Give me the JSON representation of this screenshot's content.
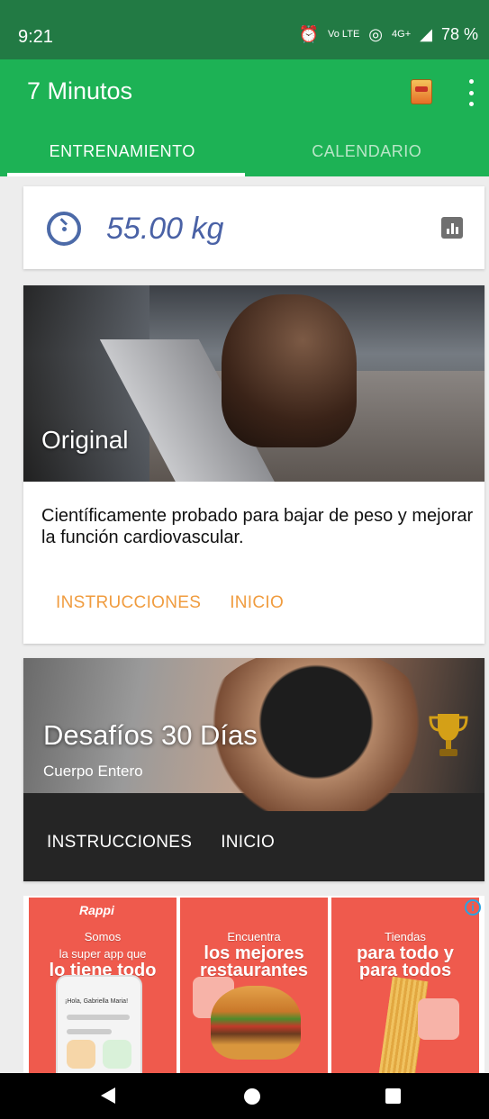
{
  "status_bar": {
    "time": "9:21",
    "icons": [
      "alarm-icon",
      "volte-icon",
      "hotspot-icon",
      "signal-icon",
      "battery-icon"
    ],
    "network": "4G+",
    "volte": "Vo LTE",
    "battery": "78 %"
  },
  "app_bar": {
    "title": "7 Minutos",
    "color": "#1db255"
  },
  "tabs": [
    {
      "label": "ENTRENAMIENTO",
      "active": true
    },
    {
      "label": "CALENDARIO",
      "active": false
    }
  ],
  "weight_card": {
    "value": "55.00 kg"
  },
  "original_card": {
    "title": "Original",
    "description": "Científicamente probado para bajar de peso y mejorar la función cardiovascular.",
    "actions": [
      "INSTRUCCIONES",
      "INICIO"
    ],
    "accent": "#f09c3f"
  },
  "challenge_card": {
    "title": "Desafíos 30 Días",
    "subtitle": "Cuerpo Entero",
    "actions": [
      "INSTRUCCIONES",
      "INICIO"
    ]
  },
  "ad": {
    "tiles": [
      {
        "brand": "Rappi",
        "line1": "Somos",
        "line2": "la super app que",
        "line3": "lo tiene todo",
        "phone_text": "¡Hola, Gabriella Maria!"
      },
      {
        "line1": "Encuentra",
        "line2": "los mejores",
        "line3": "restaurantes"
      },
      {
        "line1": "Tiendas",
        "line2": "para todo y",
        "line3": "para todos"
      }
    ]
  }
}
